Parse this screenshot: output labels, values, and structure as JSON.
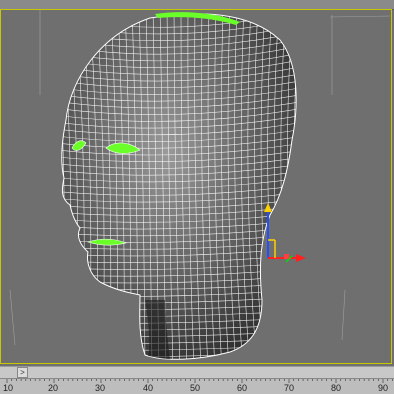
{
  "timeline": {
    "arrow_glyph": ">",
    "labels": [
      "10",
      "20",
      "30",
      "40",
      "50",
      "60",
      "70",
      "80",
      "90"
    ]
  },
  "colors": {
    "viewport_bg": "#6f6f6f",
    "mesh_line": "#ffffff",
    "selection": "#6bff2a",
    "gizmo_z": "#2050ff",
    "gizmo_y": "#ffd000",
    "gizmo_x": "#ff2020"
  },
  "icons": {
    "scroll_right": "chevron-right-icon"
  }
}
